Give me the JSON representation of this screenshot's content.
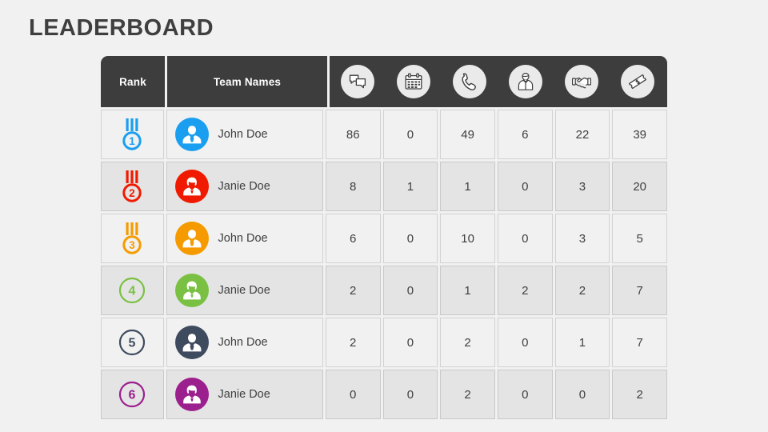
{
  "page": {
    "title": "LEADERBOARD",
    "background_color": "#f1f1f1",
    "header_background": "#3d3d3d",
    "row_light": "#f1f1f1",
    "row_dark": "#e4e4e4",
    "text_color": "#3f3f3f"
  },
  "table": {
    "columns": [
      {
        "key": "rank",
        "label": "Rank",
        "type": "text"
      },
      {
        "key": "team",
        "label": "Team Names",
        "type": "text"
      },
      {
        "key": "chats",
        "label": "",
        "icon": "chat-bubbles-icon"
      },
      {
        "key": "meetings",
        "label": "",
        "icon": "calendar-icon"
      },
      {
        "key": "calls",
        "label": "",
        "icon": "phone-icon"
      },
      {
        "key": "contacts",
        "label": "",
        "icon": "businessman-icon"
      },
      {
        "key": "deals",
        "label": "",
        "icon": "handshake-icon"
      },
      {
        "key": "tickets",
        "label": "",
        "icon": "ticket-dollar-icon"
      }
    ],
    "rows": [
      {
        "rank": "1",
        "rank_style": "medal",
        "rank_color": "#1a9ff0",
        "name": "John Doe",
        "avatar": "male",
        "avatar_color": "#1a9ff0",
        "shade": "light",
        "values": [
          "86",
          "0",
          "49",
          "6",
          "22",
          "39"
        ]
      },
      {
        "rank": "2",
        "rank_style": "medal",
        "rank_color": "#f01a00",
        "name": "Janie Doe",
        "avatar": "female",
        "avatar_color": "#f01a00",
        "shade": "dark",
        "values": [
          "8",
          "1",
          "1",
          "0",
          "3",
          "20"
        ]
      },
      {
        "rank": "3",
        "rank_style": "medal",
        "rank_color": "#f59b00",
        "name": "John Doe",
        "avatar": "male",
        "avatar_color": "#f59b00",
        "shade": "light",
        "values": [
          "6",
          "0",
          "10",
          "0",
          "3",
          "5"
        ]
      },
      {
        "rank": "4",
        "rank_style": "circle",
        "rank_color": "#7ac143",
        "name": "Janie Doe",
        "avatar": "female",
        "avatar_color": "#7ac143",
        "shade": "dark",
        "values": [
          "2",
          "0",
          "1",
          "2",
          "2",
          "7"
        ]
      },
      {
        "rank": "5",
        "rank_style": "circle",
        "rank_color": "#3e4b5e",
        "name": "John Doe",
        "avatar": "male",
        "avatar_color": "#3e4b5e",
        "shade": "light",
        "values": [
          "2",
          "0",
          "2",
          "0",
          "1",
          "7"
        ]
      },
      {
        "rank": "6",
        "rank_style": "circle",
        "rank_color": "#9c1f8e",
        "name": "Janie Doe",
        "avatar": "female",
        "avatar_color": "#9c1f8e",
        "shade": "dark",
        "values": [
          "0",
          "0",
          "2",
          "0",
          "0",
          "2"
        ]
      }
    ]
  }
}
